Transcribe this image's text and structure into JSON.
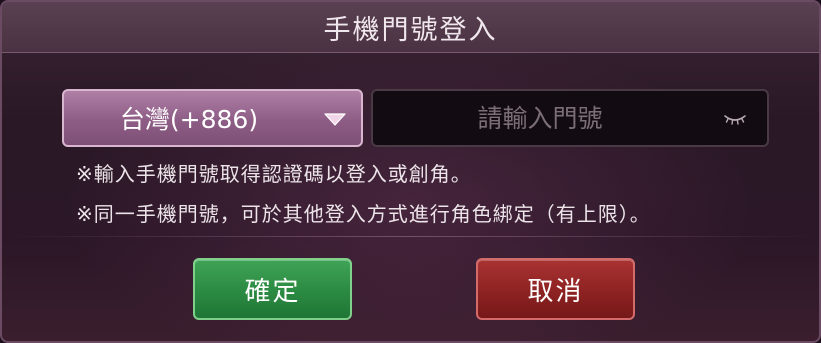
{
  "dialog": {
    "title": "手機門號登入"
  },
  "country_select": {
    "value": "台灣(+886)",
    "icon": "chevron-down-icon"
  },
  "phone_field": {
    "placeholder": "請輸入門號",
    "value": "",
    "icon": "eye-closed-icon"
  },
  "notes": [
    "※輸入手機門號取得認證碼以登入或創角。",
    "※同一手機門號，可於其他登入方式進行角色綁定（有上限）。"
  ],
  "buttons": {
    "confirm_label": "確定",
    "cancel_label": "取消"
  },
  "colors": {
    "confirm": "#2b8a42",
    "cancel": "#8e2222",
    "select": "#8e5d86"
  }
}
